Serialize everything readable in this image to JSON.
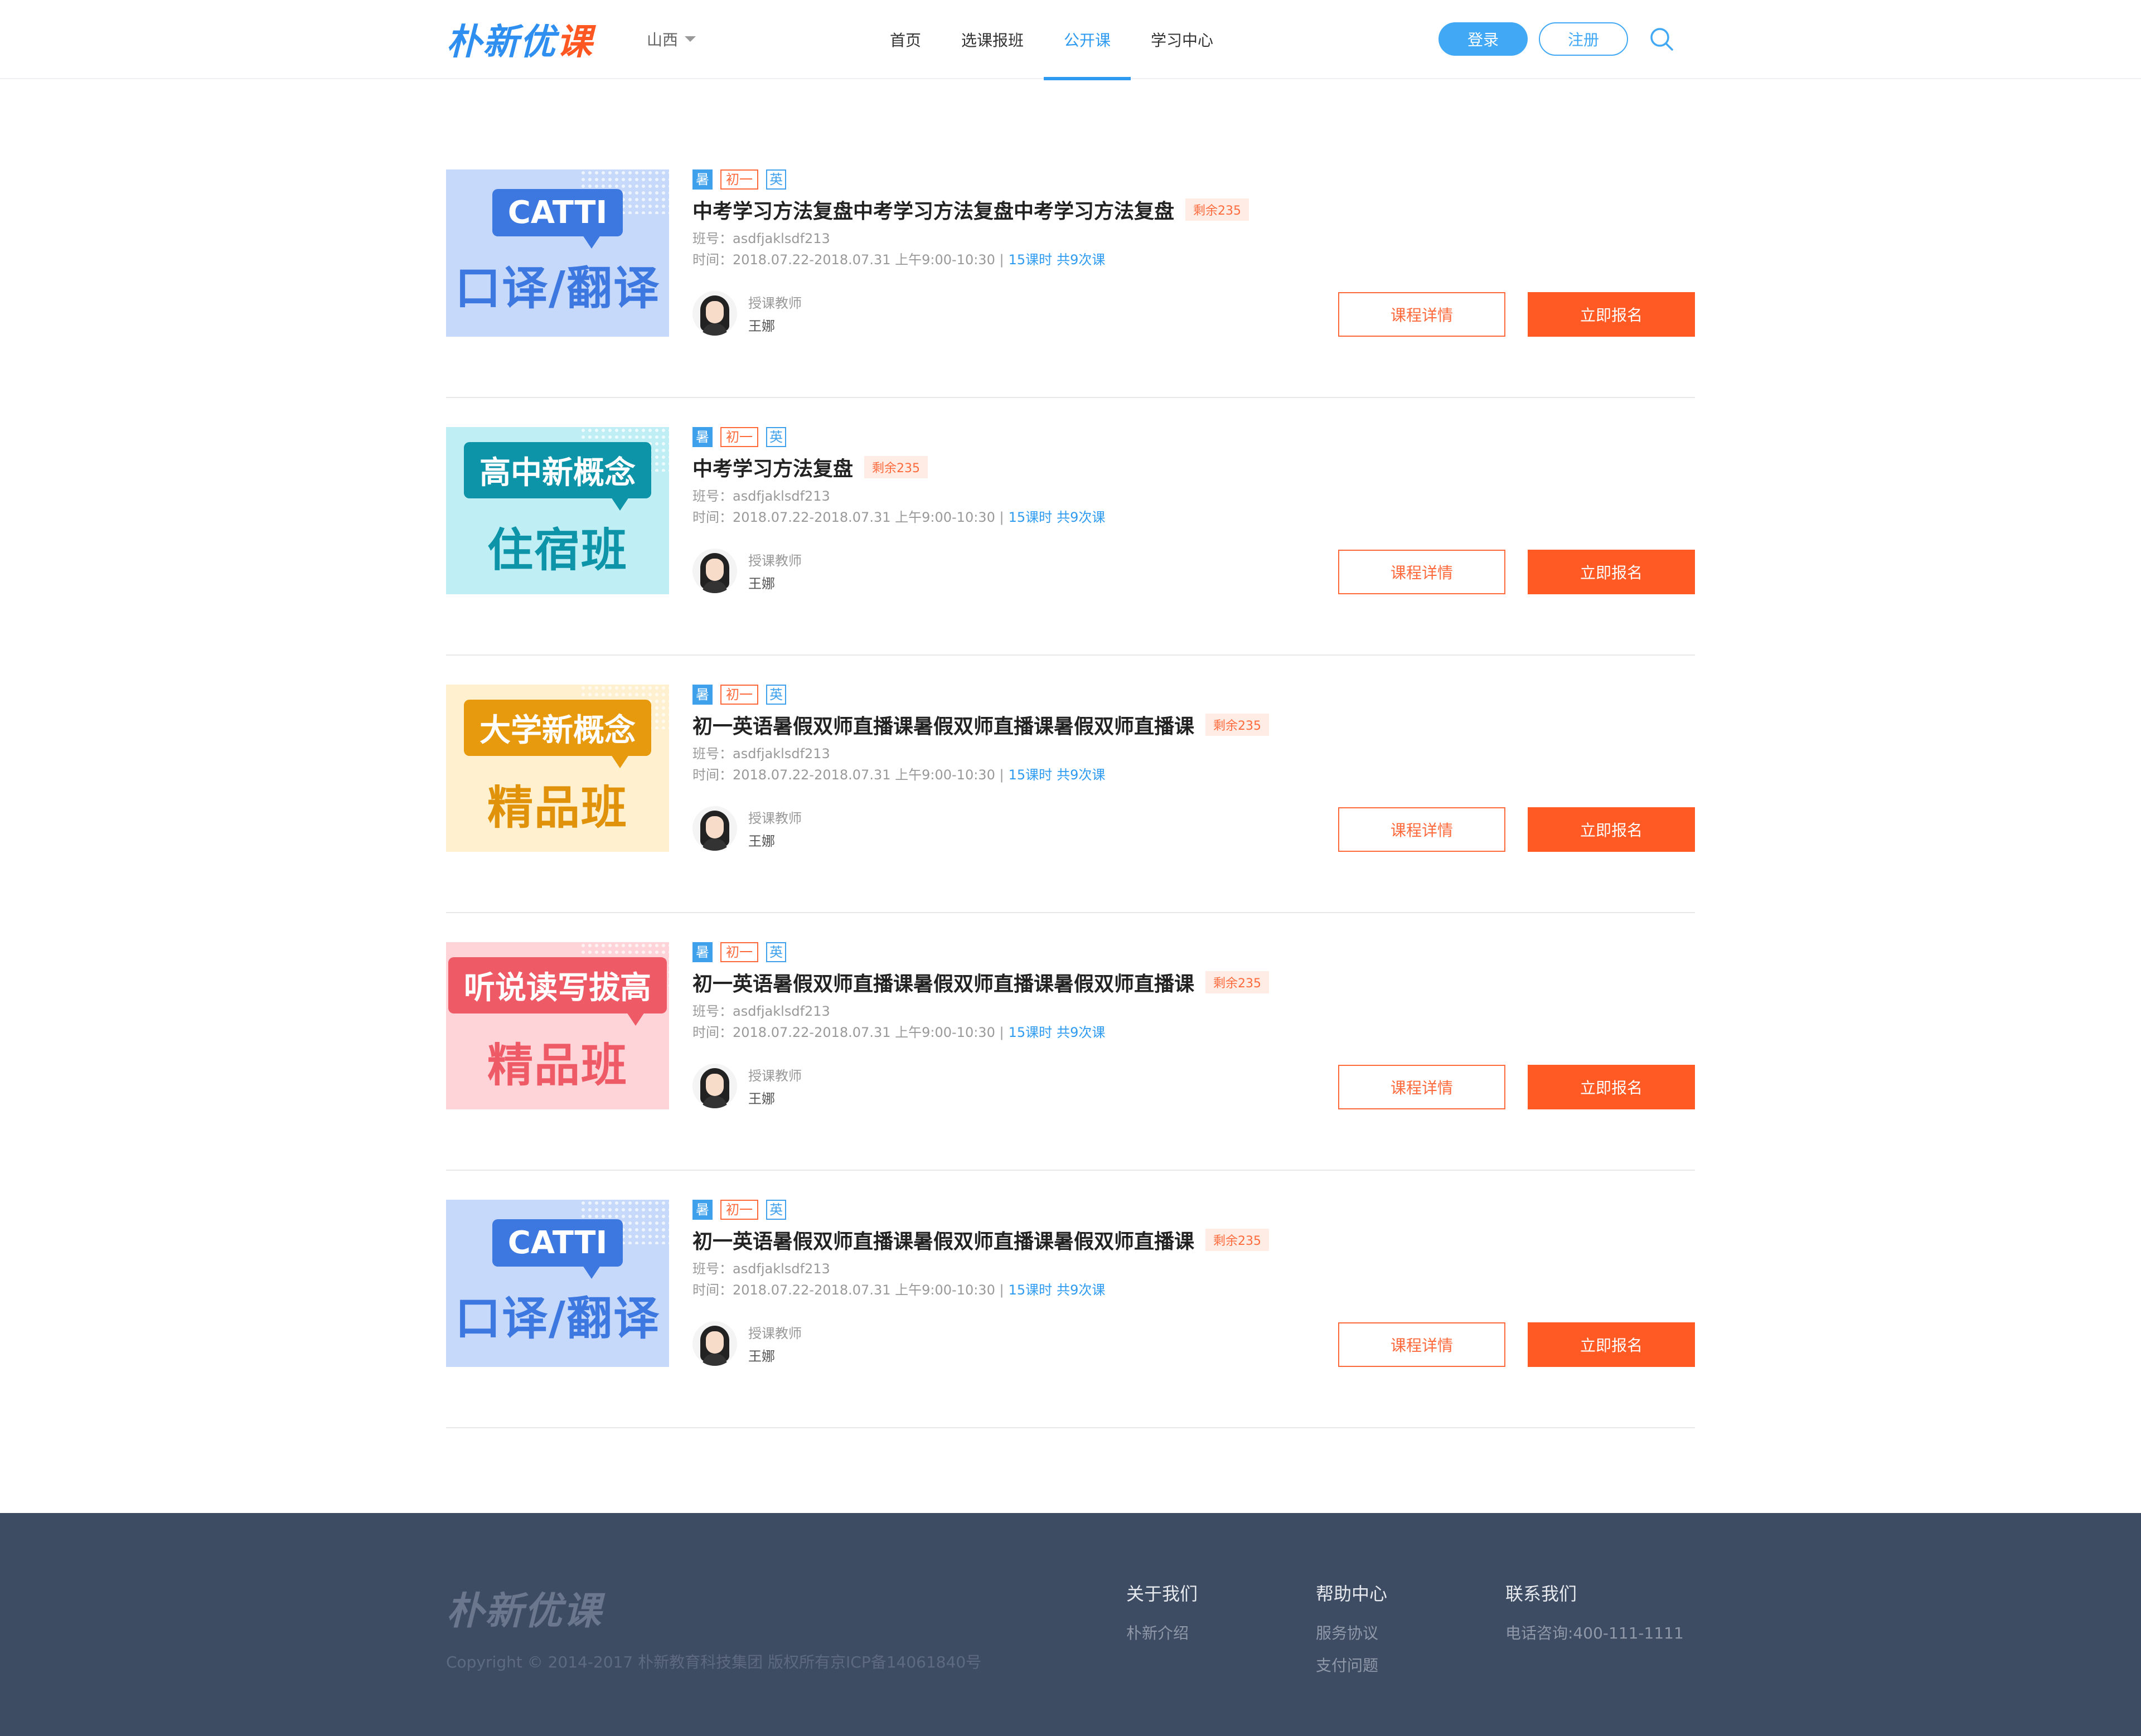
{
  "header": {
    "logo_main": "朴新优",
    "logo_accent": "课",
    "city": "山西",
    "nav": [
      "首页",
      "选课报班",
      "公开课",
      "学习中心"
    ],
    "login": "登录",
    "register": "注册"
  },
  "course_labels": {
    "teacher_role": "授课教师",
    "detail_button": "课程详情",
    "enroll_button": "立即报名"
  },
  "courses": [
    {
      "cover_top": "CATTI",
      "cover_sub": "口译/翻译",
      "cover_theme": {
        "bg": "#c6d9fb",
        "bubble": "#3d78e0",
        "sub": "#3d78e0"
      },
      "tags": [
        "暑",
        "初一",
        "英"
      ],
      "title": "中考学习方法复盘中考学习方法复盘中考学习方法复盘",
      "remain": "剩余235",
      "class_no": "班号：asdfjaklsdf213",
      "time": "时间：2018.07.22-2018.07.31 上午9:00-10:30 |",
      "hours": "15课时",
      "sessions": "共9次课",
      "teacher": "王娜"
    },
    {
      "cover_top": "高中新概念",
      "cover_sub": "住宿班",
      "cover_theme": {
        "bg": "#bfeef5",
        "bubble": "#0d94a8",
        "sub": "#0d94a8"
      },
      "tags": [
        "暑",
        "初一",
        "英"
      ],
      "title": "中考学习方法复盘",
      "remain": "剩余235",
      "class_no": "班号：asdfjaklsdf213",
      "time": "时间：2018.07.22-2018.07.31 上午9:00-10:30 |",
      "hours": "15课时",
      "sessions": "共9次课",
      "teacher": "王娜"
    },
    {
      "cover_top": "大学新概念",
      "cover_sub": "精品班",
      "cover_theme": {
        "bg": "#fff1cf",
        "bubble": "#e89a0e",
        "sub": "#e0930a"
      },
      "tags": [
        "暑",
        "初一",
        "英"
      ],
      "title": "初一英语暑假双师直播课暑假双师直播课暑假双师直播课",
      "remain": "剩余235",
      "class_no": "班号：asdfjaklsdf213",
      "time": "时间：2018.07.22-2018.07.31 上午9:00-10:30 |",
      "hours": "15课时",
      "sessions": "共9次课",
      "teacher": "王娜"
    },
    {
      "cover_top": "听说读写拔高",
      "cover_sub": "精品班",
      "cover_theme": {
        "bg": "#ffd4d8",
        "bubble": "#ee5a66",
        "sub": "#ee5a66"
      },
      "tags": [
        "暑",
        "初一",
        "英"
      ],
      "title": "初一英语暑假双师直播课暑假双师直播课暑假双师直播课",
      "remain": "剩余235",
      "class_no": "班号：asdfjaklsdf213",
      "time": "时间：2018.07.22-2018.07.31 上午9:00-10:30 |",
      "hours": "15课时",
      "sessions": "共9次课",
      "teacher": "王娜"
    },
    {
      "cover_top": "CATTI",
      "cover_sub": "口译/翻译",
      "cover_theme": {
        "bg": "#c6d9fb",
        "bubble": "#3d78e0",
        "sub": "#3d78e0"
      },
      "tags": [
        "暑",
        "初一",
        "英"
      ],
      "title": "初一英语暑假双师直播课暑假双师直播课暑假双师直播课",
      "remain": "剩余235",
      "class_no": "班号：asdfjaklsdf213",
      "time": "时间：2018.07.22-2018.07.31 上午9:00-10:30 |",
      "hours": "15课时",
      "sessions": "共9次课",
      "teacher": "王娜"
    }
  ],
  "footer": {
    "logo": "朴新优课",
    "copyright": "Copyright © 2014-2017 朴新教育科技集团 版权所有京ICP备14061840号",
    "about": {
      "title": "关于我们",
      "items": [
        "朴新介绍"
      ]
    },
    "help": {
      "title": "帮助中心",
      "items": [
        "服务协议",
        "支付问题"
      ]
    },
    "contact": {
      "title": "联系我们",
      "items": [
        "电话咨询:400-111-1111"
      ]
    }
  }
}
